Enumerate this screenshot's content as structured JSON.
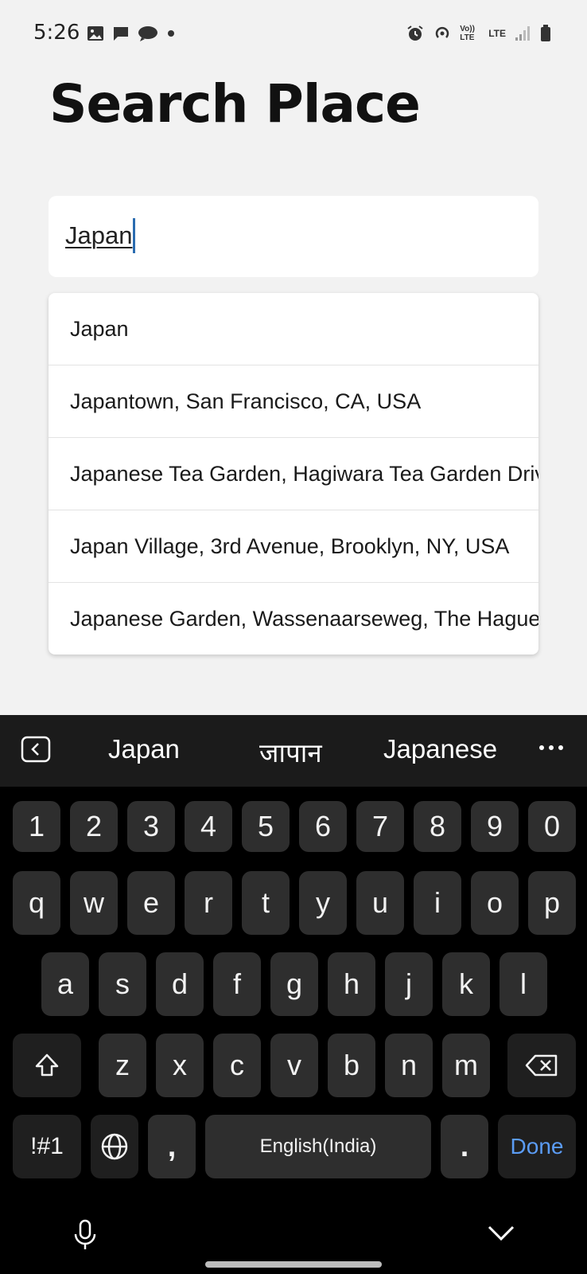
{
  "status_bar": {
    "time": "5:26",
    "left_icons": [
      "gallery-icon",
      "chat-icon",
      "chat-bubble-icon",
      "dot-icon"
    ],
    "right_icons": [
      "alarm-icon",
      "hotspot-icon",
      "volte-icon",
      "lte-icon",
      "signal-icon",
      "battery-icon"
    ],
    "volte_label": "Vo)) LTE",
    "lte_label": "LTE"
  },
  "page": {
    "title": "Search Place"
  },
  "search": {
    "value": "Japan"
  },
  "suggestions": [
    "Japan",
    "Japantown, San Francisco, CA, USA",
    "Japanese Tea Garden, Hagiwara Tea Garden Drive",
    "Japan Village, 3rd Avenue, Brooklyn, NY, USA",
    "Japanese Garden, Wassenaarseweg, The Hague"
  ],
  "keyboard": {
    "word_suggestions": [
      "Japan",
      "जापान",
      "Japanese"
    ],
    "number_row": [
      "1",
      "2",
      "3",
      "4",
      "5",
      "6",
      "7",
      "8",
      "9",
      "0"
    ],
    "row1": [
      "q",
      "w",
      "e",
      "r",
      "t",
      "y",
      "u",
      "i",
      "o",
      "p"
    ],
    "row2": [
      "a",
      "s",
      "d",
      "f",
      "g",
      "h",
      "j",
      "k",
      "l"
    ],
    "row3": [
      "z",
      "x",
      "c",
      "v",
      "b",
      "n",
      "m"
    ],
    "symbols_label": "!#1",
    "comma_label": ",",
    "space_label": "English(India)",
    "period_label": ".",
    "done_label": "Done",
    "accent_color": "#5b9cf5"
  }
}
